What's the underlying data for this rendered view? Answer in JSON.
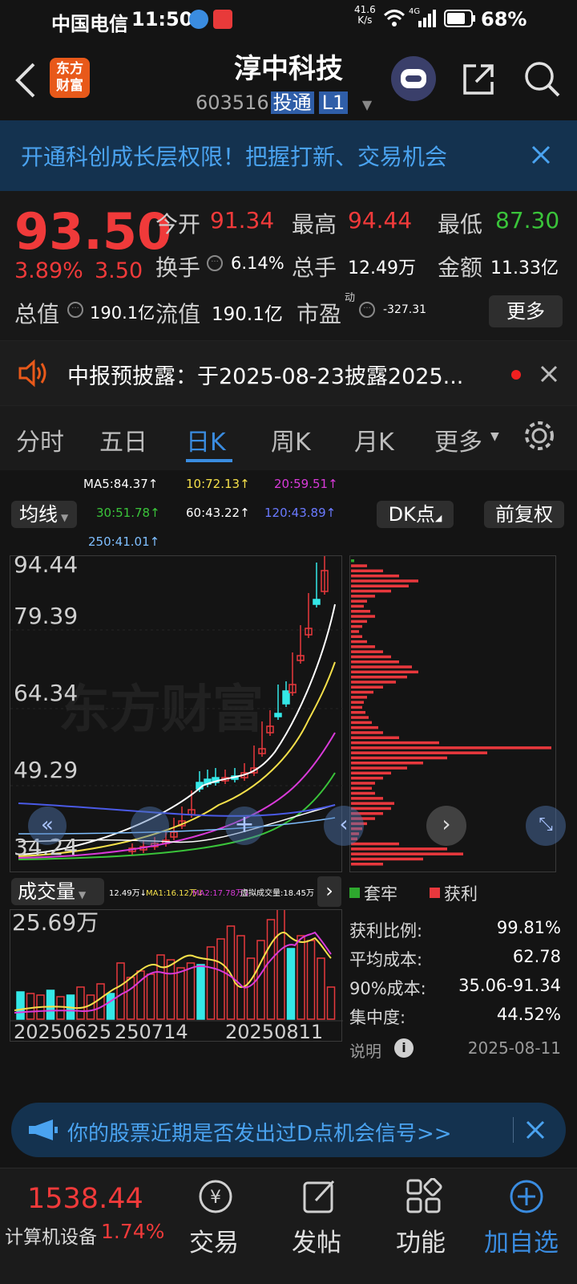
{
  "status_bar": {
    "carrier": "中国电信",
    "time": "11:50",
    "net_speed_top": "41.6",
    "net_speed_bottom": "K/s",
    "signal_label": "4G",
    "battery": "68%"
  },
  "header": {
    "logo_line1": "东方",
    "logo_line2": "财富",
    "title": "淳中科技",
    "code": "603516",
    "tag": "投通",
    "level": "L1"
  },
  "banner": {
    "text": "开通科创成长层权限！把握打新、交易机会"
  },
  "quote": {
    "price": "93.50",
    "change_pct": "3.89%",
    "change_amt": "3.50",
    "open_label": "今开",
    "open": "91.34",
    "high_label": "最高",
    "high": "94.44",
    "low_label": "最低",
    "low": "87.30",
    "turnover_label": "换手",
    "turnover": "6.14%",
    "volume_label": "总手",
    "volume": "12.49万",
    "amount_label": "金额",
    "amount": "11.33亿",
    "mktcap_label": "总值",
    "mktcap": "190.1亿",
    "float_label": "流值",
    "float": "190.1亿",
    "pe_label": "市盈",
    "pe_sup": "动",
    "pe": "-327.31",
    "more": "更多"
  },
  "notice": {
    "text": "中报预披露：于2025-08-23披露2025..."
  },
  "tabs": [
    {
      "label": "分时"
    },
    {
      "label": "五日"
    },
    {
      "label": "日K"
    },
    {
      "label": "周K"
    },
    {
      "label": "月K"
    },
    {
      "label": "更多"
    }
  ],
  "ma_legend": {
    "ma5": "MA5:84.37↑",
    "ma10": "10:72.13↑",
    "ma20": "20:59.51↑",
    "ma30": "30:51.78↑",
    "ma60": "60:43.22↑",
    "ma120": "120:43.89↑",
    "ma250": "250:41.01↑"
  },
  "colors": {
    "ma5": "#ffffff",
    "ma10": "#f5e04a",
    "ma20": "#d93ad9",
    "ma30": "#3ac43a",
    "ma60": "#ffffff",
    "ma120": "#4a5ae6",
    "ma250": "#7fbfff",
    "up": "#e8383d",
    "down": "#34e8e8"
  },
  "controls": {
    "avg_line": "均线",
    "dk_point": "DK点",
    "adjust": "前复权"
  },
  "price_axis": [
    "94.44",
    "79.39",
    "64.34",
    "49.29",
    "34.24"
  ],
  "watermark": "东方财富",
  "volume": {
    "label": "成交量",
    "cur": "12.49万↓",
    "ma1": "MA1:16.12万↓",
    "ma2": "MA2:17.78万↓",
    "virtual": "虚拟成交量:18.45万",
    "axis_max": "25.69万",
    "date_left": "20250625",
    "date_mid": "250714",
    "date_right": "20250811"
  },
  "chip": {
    "legend_trapped": "套牢",
    "legend_profit": "获利",
    "rows": [
      {
        "label": "获利比例:",
        "value": "99.81%"
      },
      {
        "label": "平均成本:",
        "value": "62.78"
      },
      {
        "label": "90%成本:",
        "value": "35.06-91.34"
      },
      {
        "label": "集中度:",
        "value": "44.52%"
      }
    ],
    "explain": "说明",
    "date": "2025-08-11"
  },
  "promo": {
    "text": "你的股票近期是否发出过D点机会信号>>"
  },
  "bottom": {
    "index_value": "1538.44",
    "index_name": "计算机设备",
    "index_pct": "1.74%",
    "nav": [
      {
        "label": "交易"
      },
      {
        "label": "发帖"
      },
      {
        "label": "功能"
      },
      {
        "label": "加自选"
      }
    ]
  }
}
